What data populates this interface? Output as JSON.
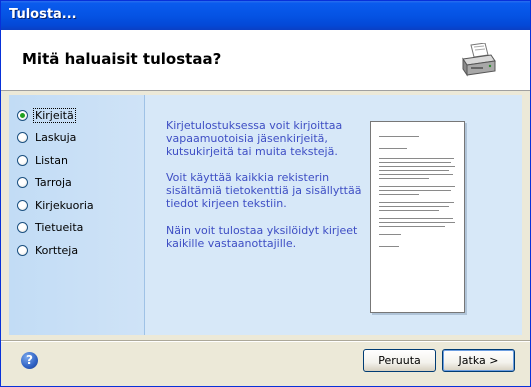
{
  "window": {
    "title": "Tulosta..."
  },
  "header": {
    "heading": "Mitä haluaisit tulostaa?",
    "icon": "printer-icon"
  },
  "options": [
    {
      "label": "Kirjeitä",
      "selected": true
    },
    {
      "label": "Laskuja",
      "selected": false
    },
    {
      "label": "Listan",
      "selected": false
    },
    {
      "label": "Tarroja",
      "selected": false
    },
    {
      "label": "Kirjekuoria",
      "selected": false
    },
    {
      "label": "Tietueita",
      "selected": false
    },
    {
      "label": "Kortteja",
      "selected": false
    }
  ],
  "description": {
    "p1": "Kirjetulostuksessa voit kirjoittaa vapaamuotoisia jäsenkirjeitä, kutsukirjeitä tai muita tekstejä.",
    "p2": "Voit käyttää kaikkia rekisterin sisältämiä tietokenttiä ja sisällyttää tiedot kirjeen tekstiin.",
    "p3": "Näin voit tulostaa yksilöidyt kirjeet kaikille vastaanottajille."
  },
  "buttons": {
    "help": "?",
    "cancel": "Peruuta",
    "next": "Jatka >"
  },
  "colors": {
    "titlebar": "#0553e4",
    "description_text": "#3e4ec4",
    "radio_dot": "#21a121"
  }
}
